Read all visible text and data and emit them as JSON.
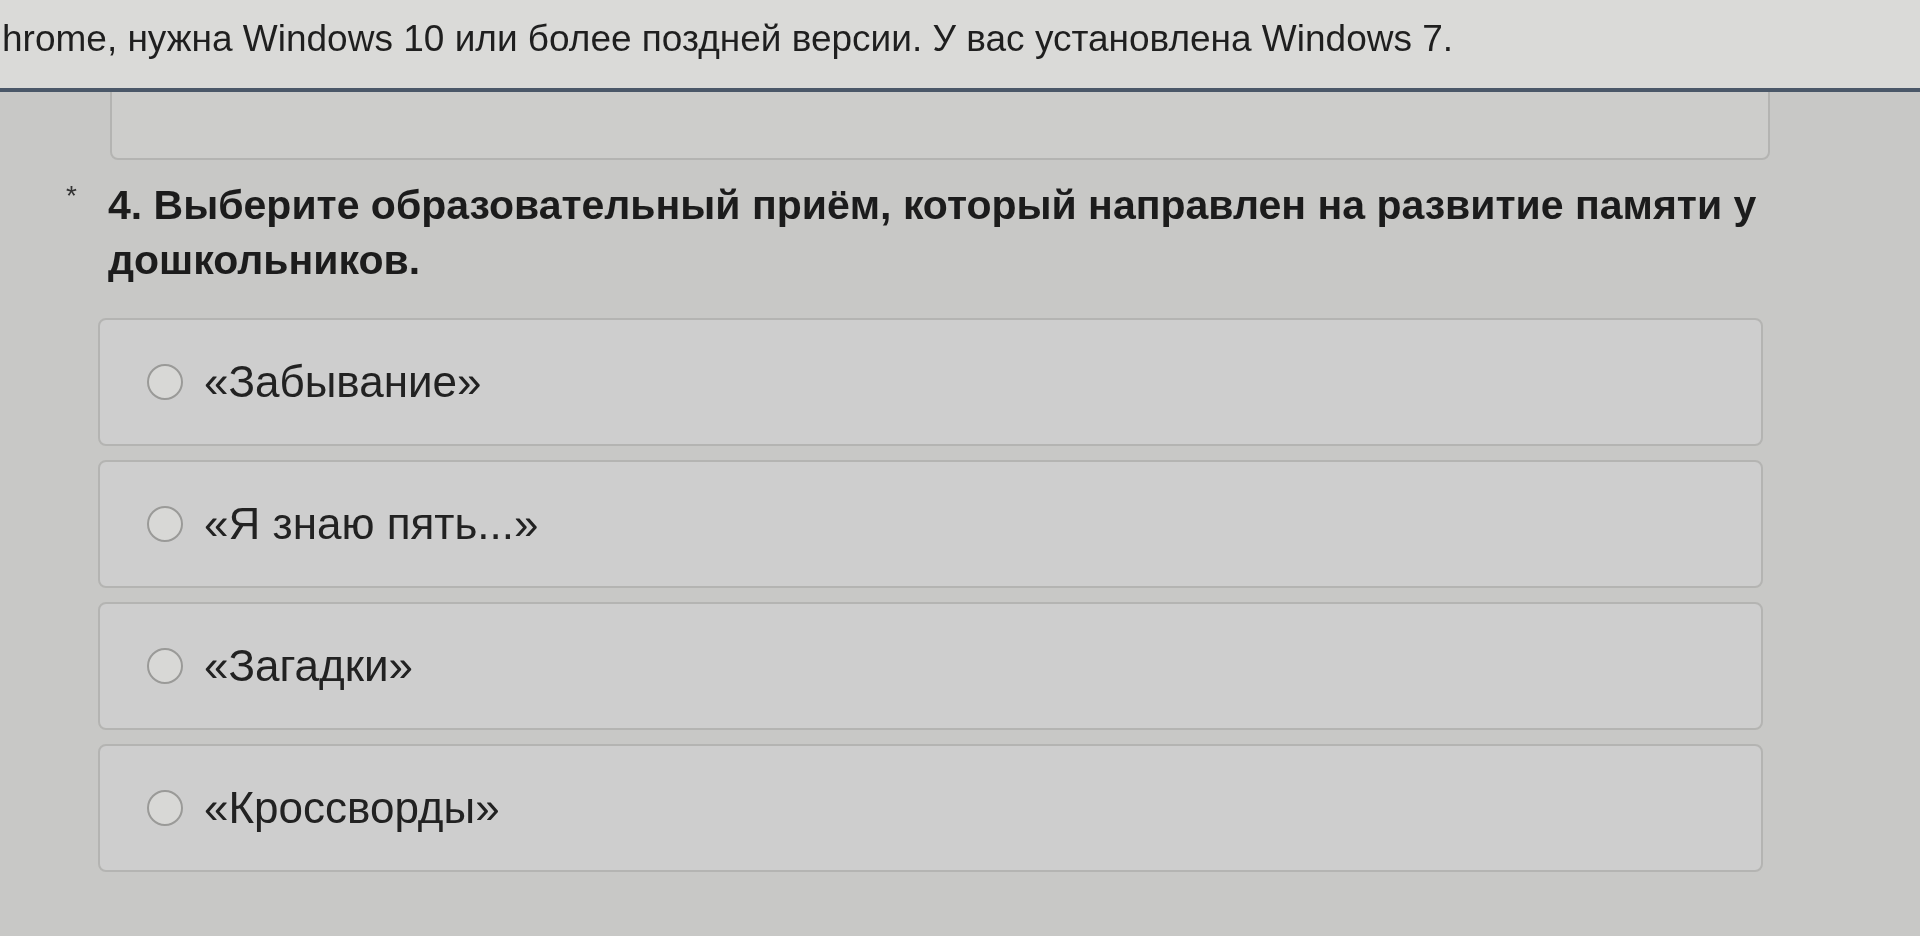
{
  "banner": {
    "text": "hrome, нужна Windows 10 или более поздней версии. У вас установлена Windows 7."
  },
  "question": {
    "required_mark": "*",
    "text": "4. Выберите образовательный приём, который направлен на развитие памяти у дошкольников."
  },
  "options": [
    {
      "label": "«Забывание»",
      "selected": false
    },
    {
      "label": "«Я знаю пять...»",
      "selected": false
    },
    {
      "label": "«Загадки»",
      "selected": false
    },
    {
      "label": "«Кроссворды»",
      "selected": false
    }
  ]
}
